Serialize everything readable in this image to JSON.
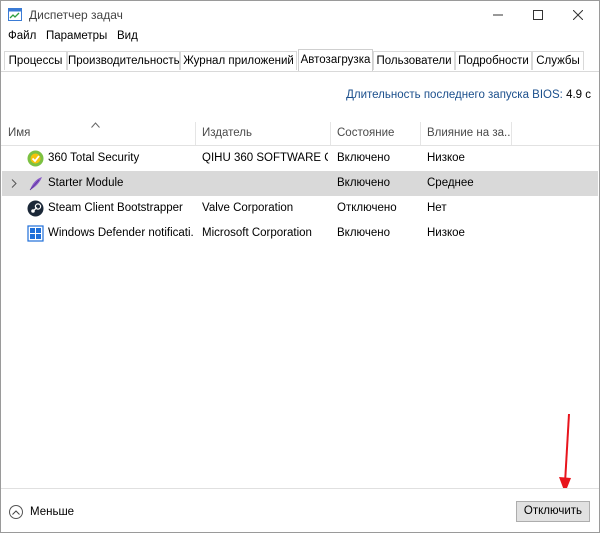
{
  "window": {
    "title": "Диспетчер задач"
  },
  "menu": [
    "Файл",
    "Параметры",
    "Вид"
  ],
  "tabs": [
    {
      "label": "Процессы",
      "active": false
    },
    {
      "label": "Производительность",
      "active": false
    },
    {
      "label": "Журнал приложений",
      "active": false
    },
    {
      "label": "Автозагрузка",
      "active": true
    },
    {
      "label": "Пользователи",
      "active": false
    },
    {
      "label": "Подробности",
      "active": false
    },
    {
      "label": "Службы",
      "active": false
    }
  ],
  "bios": {
    "label": "Длительность последнего запуска BIOS:",
    "value": "4.9 с"
  },
  "columns": {
    "name": "Имя",
    "publisher": "Издатель",
    "status": "Состояние",
    "impact": "Влияние на за..."
  },
  "rows": [
    {
      "name": "360 Total Security",
      "publisher": "QIHU 360 SOFTWARE C...",
      "status": "Включено",
      "impact": "Низкое",
      "icon": "360-security-icon",
      "selected": false,
      "expandable": false
    },
    {
      "name": "Starter Module",
      "publisher": "",
      "status": "Включено",
      "impact": "Среднее",
      "icon": "feather-icon",
      "selected": true,
      "expandable": true
    },
    {
      "name": "Steam Client Bootstrapper",
      "publisher": "Valve Corporation",
      "status": "Отключено",
      "impact": "Нет",
      "icon": "steam-icon",
      "selected": false,
      "expandable": false
    },
    {
      "name": "Windows Defender notificati...",
      "publisher": "Microsoft Corporation",
      "status": "Включено",
      "impact": "Низкое",
      "icon": "windows-defender-icon",
      "selected": false,
      "expandable": false
    }
  ],
  "footer": {
    "less_label": "Меньше",
    "disable_label": "Отключить"
  },
  "colors": {
    "selected_row": "#d9d9d9",
    "annotation_arrow": "#e8141c",
    "bios_label": "#1b4f8c"
  }
}
